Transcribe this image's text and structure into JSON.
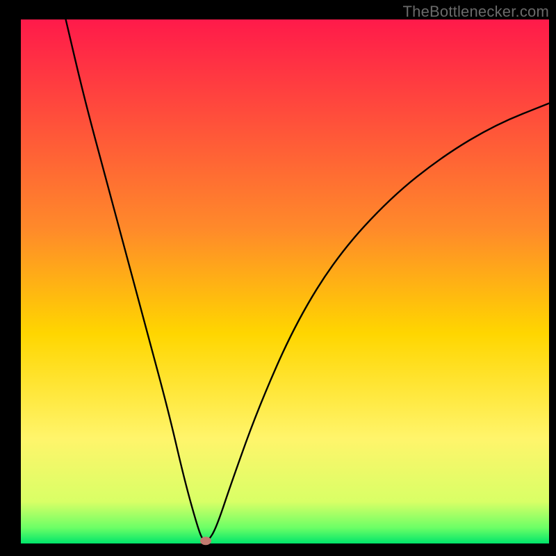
{
  "attribution": "TheBottlenecker.com",
  "chart_data": {
    "type": "line",
    "title": "",
    "xlabel": "",
    "ylabel": "",
    "xlim": [
      0,
      100
    ],
    "ylim": [
      0,
      100
    ],
    "grid": false,
    "legend": false,
    "gradient_stops": [
      {
        "offset": 0,
        "color": "#ff1a4a"
      },
      {
        "offset": 40,
        "color": "#ff8a2a"
      },
      {
        "offset": 60,
        "color": "#ffd600"
      },
      {
        "offset": 80,
        "color": "#fff56b"
      },
      {
        "offset": 92,
        "color": "#d9ff66"
      },
      {
        "offset": 97,
        "color": "#6cff66"
      },
      {
        "offset": 100,
        "color": "#00e56b"
      }
    ],
    "curve": [
      {
        "x": 8.5,
        "y": 100
      },
      {
        "x": 12,
        "y": 85
      },
      {
        "x": 16,
        "y": 70
      },
      {
        "x": 20,
        "y": 55
      },
      {
        "x": 24,
        "y": 40
      },
      {
        "x": 28,
        "y": 25
      },
      {
        "x": 31,
        "y": 12
      },
      {
        "x": 33.5,
        "y": 3
      },
      {
        "x": 34.5,
        "y": 0.5
      },
      {
        "x": 35.5,
        "y": 0.5
      },
      {
        "x": 37,
        "y": 3
      },
      {
        "x": 40,
        "y": 12
      },
      {
        "x": 45,
        "y": 26
      },
      {
        "x": 52,
        "y": 42
      },
      {
        "x": 60,
        "y": 55
      },
      {
        "x": 70,
        "y": 66
      },
      {
        "x": 80,
        "y": 74
      },
      {
        "x": 90,
        "y": 80
      },
      {
        "x": 100,
        "y": 84
      }
    ],
    "marker": {
      "x": 35,
      "y": 0.5,
      "color": "#c27a70"
    }
  }
}
